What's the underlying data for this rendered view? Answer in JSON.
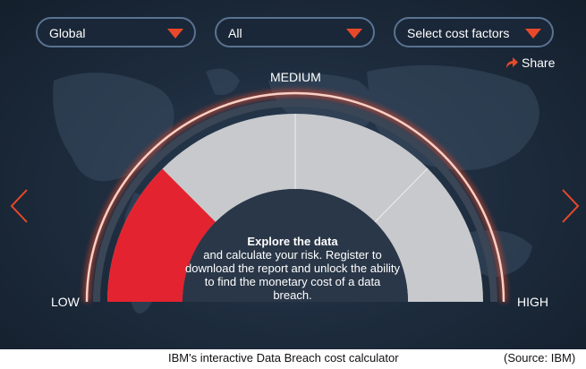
{
  "filters": {
    "region": {
      "selected": "Global"
    },
    "industry": {
      "selected": "All"
    },
    "cost_factors": {
      "placeholder": "Select cost factors"
    }
  },
  "share_label": "Share",
  "gauge": {
    "label_low": "LOW",
    "label_medium": "MEDIUM",
    "label_high": "HIGH",
    "fill_fraction": 0.25,
    "fill_color": "#e3232f",
    "ring_color": "#e8492a"
  },
  "explore": {
    "title": "Explore the data",
    "body": "and calculate your risk. Register to download the report and unlock the ability to find the monetary cost of a data breach."
  },
  "colors": {
    "accent": "#e8492a",
    "background": "#1e2d3f"
  },
  "caption": "IBM's interactive Data Breach cost calculator",
  "source": "(Source: IBM)"
}
